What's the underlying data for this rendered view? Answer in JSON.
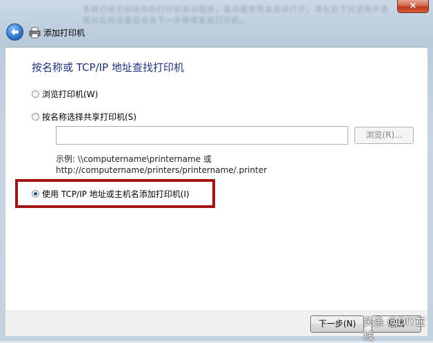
{
  "window": {
    "close_label": "×",
    "background_text": "系统已经识别出你的打印机驱动程序，驱动程序将会自动打开，请在如下对话框中选择对应的设备后点击下一步继续安装打印机。"
  },
  "header": {
    "title": "添加打印机",
    "back_icon": "back-arrow-icon",
    "printer_icon": "printer-icon"
  },
  "main": {
    "heading": "按名称或 TCP/IP 地址查找打印机",
    "option_browse": "浏览打印机(W)",
    "option_shared": "按名称选择共享打印机(S)",
    "shared_input_value": "",
    "browse_button": "浏览(R)...",
    "example_line1": "示例: \\\\computername\\printername 或",
    "example_line2": "http://computername/printers/printername/.printer",
    "option_tcpip": "使用 TCP/IP 地址或主机名添加打印机(I)",
    "selected_option": "tcpip",
    "highlight_color": "#a31515"
  },
  "footer": {
    "next_button": "下一步(N)",
    "cancel_button": "取消",
    "watermark": "头条 @DIY在线"
  }
}
